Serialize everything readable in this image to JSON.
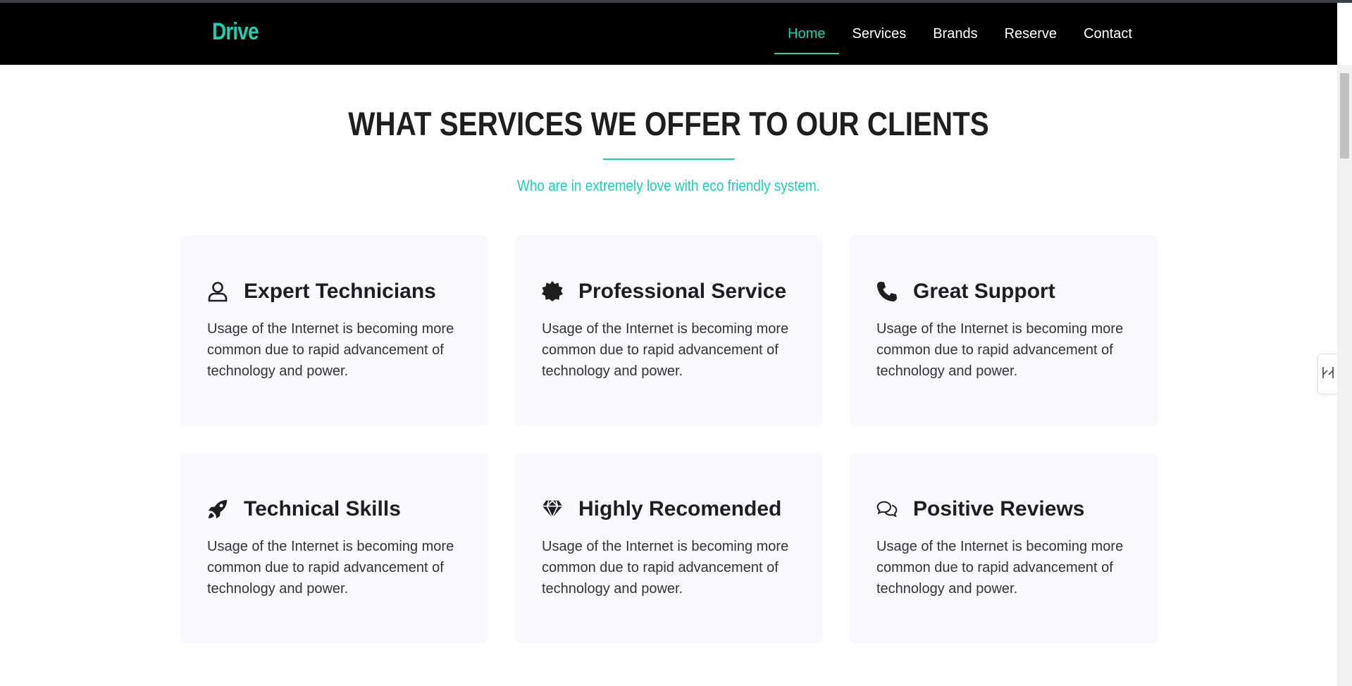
{
  "brand": "Drive",
  "nav": [
    {
      "label": "Home",
      "active": true
    },
    {
      "label": "Services",
      "active": false
    },
    {
      "label": "Brands",
      "active": false
    },
    {
      "label": "Reserve",
      "active": false
    },
    {
      "label": "Contact",
      "active": false
    }
  ],
  "section": {
    "title": "WHAT SERVICES WE OFFER TO OUR CLIENTS",
    "subtitle": "Who are in extremely love with eco friendly system."
  },
  "cards": [
    {
      "icon": "user-icon",
      "title": "Expert Technicians",
      "text": "Usage of the Internet is becoming more common due to rapid advancement of technology and power."
    },
    {
      "icon": "badge-icon",
      "title": "Professional Service",
      "text": "Usage of the Internet is becoming more common due to rapid advancement of technology and power."
    },
    {
      "icon": "phone-icon",
      "title": "Great Support",
      "text": "Usage of the Internet is becoming more common due to rapid advancement of technology and power."
    },
    {
      "icon": "rocket-icon",
      "title": "Technical Skills",
      "text": "Usage of the Internet is becoming more common due to rapid advancement of technology and power."
    },
    {
      "icon": "diamond-icon",
      "title": "Highly Recomended",
      "text": "Usage of the Internet is becoming more common due to rapid advancement of technology and power."
    },
    {
      "icon": "comments-icon",
      "title": "Positive Reviews",
      "text": "Usage of the Internet is becoming more common due to rapid advancement of technology and power."
    }
  ],
  "colors": {
    "accent": "#1dd1b0",
    "navbar": "#000000",
    "card_bg": "#f8f8fd"
  }
}
